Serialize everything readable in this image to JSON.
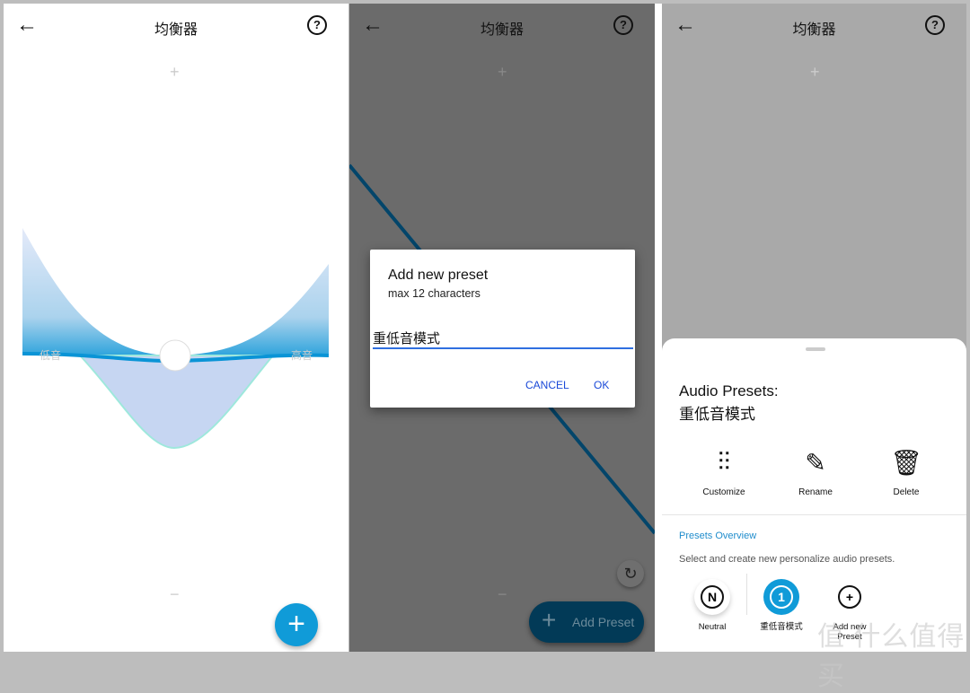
{
  "header": {
    "title": "均衡器",
    "back_icon": "arrow-left-icon",
    "help_icon": "question-circle-icon"
  },
  "eq": {
    "plus": "+",
    "minus": "−",
    "bass_label": "低音",
    "treble_label": "高音",
    "curve_color": "#0a94d6"
  },
  "fab": {
    "label": "+",
    "color": "#109bd8"
  },
  "dialog": {
    "title": "Add new preset",
    "subtitle": "max 12 characters",
    "input_value": "重低音模式",
    "cancel": "CANCEL",
    "ok": "OK"
  },
  "add_preset_button": {
    "label": "Add Preset",
    "icon": "+"
  },
  "reset_icon": "↻",
  "sheet": {
    "title": "Audio Presets:",
    "preset_name": "重低音模式",
    "actions": [
      {
        "icon": "sliders-icon",
        "label": "Customize"
      },
      {
        "icon": "pencil-icon",
        "label": "Rename"
      },
      {
        "icon": "trash-icon",
        "label": "Delete"
      }
    ],
    "overview_title": "Presets Overview",
    "overview_subtitle": "Select and create new personalize audio presets.",
    "presets": [
      {
        "glyph": "N",
        "label": "Neutral"
      },
      {
        "glyph": "1",
        "label": "重低音模式",
        "selected": true
      },
      {
        "glyph": "+",
        "label": "Add new Preset"
      }
    ]
  },
  "watermark": "值 什么值得买"
}
